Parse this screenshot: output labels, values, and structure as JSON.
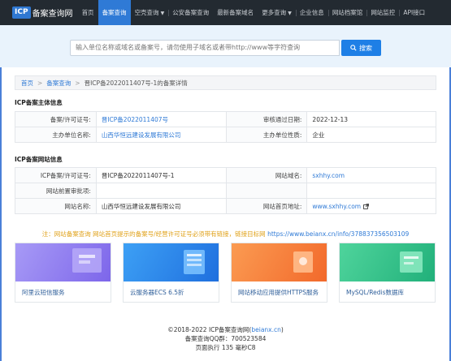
{
  "nav": {
    "logo_badge": "ICP",
    "logo_text": "备案查询网",
    "items": [
      {
        "label": "首页"
      },
      {
        "label": "备案查询"
      },
      {
        "label": "空壳查询"
      },
      {
        "label": "公安备案查询"
      },
      {
        "label": "最新备案域名"
      },
      {
        "label": "更多查询"
      },
      {
        "label": "企业信息"
      },
      {
        "label": "网站档案馆"
      },
      {
        "label": "网站监控"
      },
      {
        "label": "API接口"
      }
    ]
  },
  "search": {
    "placeholder": "输入单位名称或域名或备案号，请勿使用子域名或者带http://www等字符查询",
    "button_label": "搜索"
  },
  "breadcrumb": {
    "home": "首页",
    "section": "备案查询",
    "current": "晋ICP备2022011407号-1的备案详情"
  },
  "main_info": {
    "title": "ICP备案主体信息",
    "rows": [
      {
        "l1": "备案/许可证号:",
        "v1": "晋ICP备2022011407号",
        "l2": "审核通过日期:",
        "v2": "2022-12-13"
      },
      {
        "l1": "主办单位名称:",
        "v1": "山西华恒远建设发展有限公司",
        "l2": "主办单位性质:",
        "v2": "企业"
      }
    ]
  },
  "site_info": {
    "title": "ICP备案网站信息",
    "rows": [
      {
        "l1": "ICP备案/许可证号:",
        "v1": "晋ICP备2022011407号-1",
        "l2": "网站域名:",
        "v2": "sxhhy.com"
      },
      {
        "l1": "网站前置审批项:",
        "v1": "",
        "l2": "",
        "v2": ""
      },
      {
        "l1": "网站名称:",
        "v1": "山西华恒远建设发展有限公司",
        "l2": "网站首页地址:",
        "v2": "www.sxhhy.com"
      }
    ]
  },
  "note": {
    "text": "注：网站备案查询 网站首页提示的备案号/经营许可证号必须带有链接，链接目标网",
    "link": "https://www.beianx.cn/info/378837356503109"
  },
  "cards": [
    {
      "caption": "阿里云短信服务",
      "color": "#8f7cf0"
    },
    {
      "caption": "云服务器ECS 6.5折",
      "color": "#2e86ea"
    },
    {
      "caption": "网站移动应用提供HTTPS服务",
      "color": "#f4823a"
    },
    {
      "caption": "MySQL/Redis数据库",
      "color": "#2fc48a"
    }
  ],
  "footer": {
    "copyright": "©2018-2022 ICP备案查询网(",
    "site": "beianx.cn",
    "copyright_end": ")",
    "qq": "备案查询QQ群：700523584",
    "timing": "页面执行 135 毫秒C8"
  }
}
